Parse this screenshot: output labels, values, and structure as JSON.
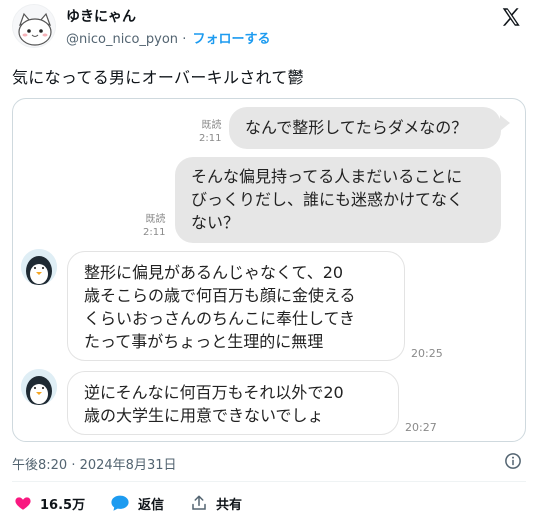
{
  "author": {
    "name": "ゆきにゃん",
    "handle": "@nico_nico_pyon",
    "separator": "·",
    "follow_label": "フォローする"
  },
  "tweet": {
    "text": "気になってる男にオーバーキルされて鬱"
  },
  "chat": {
    "messages": [
      {
        "side": "right",
        "text": "なんで整形してたらダメなの？",
        "read": "既読",
        "time": "2:11"
      },
      {
        "side": "right",
        "lines": [
          "そんな偏見持ってる人まだいることに",
          "びっくりだし、誰にも迷惑かけてなく",
          "ない？"
        ],
        "read": "既読",
        "time": "2:11"
      },
      {
        "side": "left",
        "lines": [
          "整形に偏見があるんじゃなくて、20",
          "歳そこらの歳で何百万も顔に金使える",
          "くらいおっさんのちんこに奉仕してき",
          "たって事がちょっと生理的に無理"
        ],
        "time": "20:25"
      },
      {
        "side": "left",
        "lines": [
          "逆にそんなに何百万もそれ以外で20",
          "歳の大学生に用意できないでしょ"
        ],
        "time": "20:27"
      }
    ]
  },
  "timestamp": "午後8:20 · 2024年8月31日",
  "actions": {
    "likes": "16.5万",
    "reply": "返信",
    "share": "共有"
  },
  "colors": {
    "accent": "#1d9bf0",
    "like": "#f91880",
    "bubble_right": "#e6e6e6"
  },
  "icons": [
    "x-logo-icon",
    "info-icon",
    "heart-icon",
    "reply-bubble-icon",
    "share-icon",
    "penguin-avatar-icon"
  ]
}
